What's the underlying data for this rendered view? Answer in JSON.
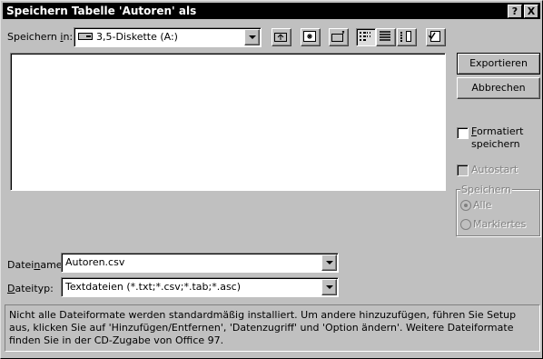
{
  "window": {
    "title": "Speichern Tabelle 'Autoren' als",
    "help_button": "?",
    "close_button": "X"
  },
  "location": {
    "label_pre": "Speichern ",
    "label_key": "i",
    "label_post": "n:",
    "value": "3,5-Diskette (A:)",
    "icon": "floppy-drive-icon"
  },
  "toolbar": {
    "buttons": [
      "up-one-level-icon",
      "desktop-icon",
      "new-folder-icon",
      "list-view-icon",
      "details-view-icon",
      "properties-view-icon",
      "commands-icon"
    ]
  },
  "buttons": {
    "export": "Exportieren",
    "cancel": "Abbrechen"
  },
  "options": {
    "formatted_key": "F",
    "formatted_rest": "ormatiert",
    "formatted_line2": "speichern",
    "formatted_checked": false,
    "autostart": "Autostart",
    "autostart_checked": false,
    "save_group": "Speichern",
    "all": "Alle",
    "selected": "Markiertes",
    "selected_option": "Alle"
  },
  "filename": {
    "label_pre": "Datei",
    "label_key": "n",
    "label_post": "ame:",
    "value": "Autoren.csv"
  },
  "filetype": {
    "label_key": "D",
    "label_post": "ateityp:",
    "value": "Textdateien (*.txt;*.csv;*.tab;*.asc)"
  },
  "status": {
    "message": "Nicht alle Dateiformate werden standardmäßig installiert. Um andere hinzuzufügen, führen Sie Setup aus, klicken Sie auf 'Hinzufügen/Entfernen', 'Datenzugriff' und 'Option ändern'. Weitere Dateiformate finden Sie in der CD-Zugabe von Office 97."
  },
  "colors": {
    "face": "#c0c0c0",
    "title_bar": "#000000",
    "disabled_text": "#808080"
  }
}
